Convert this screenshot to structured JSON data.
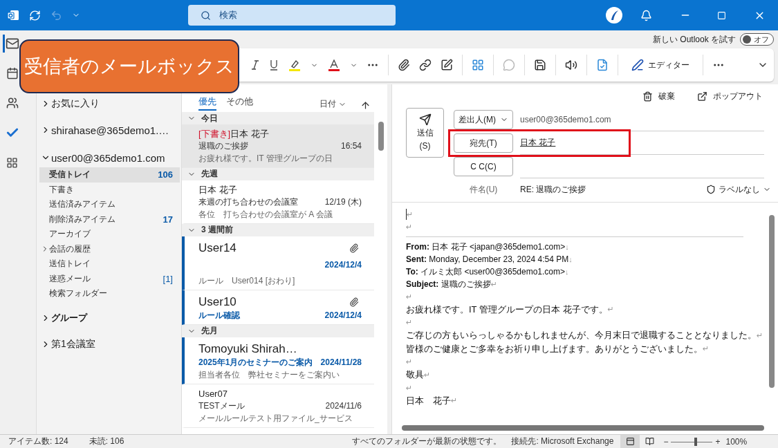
{
  "title_bar": {
    "search_placeholder": "検索"
  },
  "new_outlook": {
    "label": "新しい Outlook を試す",
    "toggle_label": "オフ",
    "on": false
  },
  "ribbon": {
    "editor_label": "エディター"
  },
  "callout": {
    "text": "受信者のメールボックス"
  },
  "nav_rail": [
    {
      "kind": "mail",
      "selected": true
    },
    {
      "kind": "calendar",
      "selected": false
    },
    {
      "kind": "people",
      "selected": false
    },
    {
      "kind": "todo",
      "selected": false
    },
    {
      "kind": "apps",
      "selected": false
    }
  ],
  "folder_tree": [
    {
      "kind": "favorites",
      "label": "お気に入り",
      "expanded": false
    },
    {
      "kind": "account",
      "label": "shirahase@365demo1.…",
      "expanded": false
    },
    {
      "kind": "account",
      "label": "user00@365demo1.com",
      "expanded": true,
      "children": [
        {
          "label": "受信トレイ",
          "count": "106",
          "selected": true
        },
        {
          "label": "下書き",
          "selected": false
        },
        {
          "label": "送信済みアイテム",
          "selected": false
        },
        {
          "label": "削除済みアイテム",
          "count": "17",
          "selected": false
        },
        {
          "label": "アーカイブ",
          "selected": false
        },
        {
          "label": "会話の履歴",
          "expanded": false,
          "selected": false
        },
        {
          "label": "送信トレイ",
          "selected": false
        },
        {
          "label": "迷惑メール",
          "count": "[1]",
          "selected": false
        },
        {
          "label": "検索フォルダー",
          "selected": false
        }
      ]
    },
    {
      "kind": "groups",
      "label": "グループ",
      "expanded": false
    },
    {
      "kind": "favorites",
      "label": "第1会議室",
      "expanded": false
    }
  ],
  "message_list": {
    "tabs": [
      {
        "label": "優先",
        "selected": true
      },
      {
        "label": "その他",
        "selected": false
      }
    ],
    "sort_label": "日付",
    "groups": [
      {
        "label": "今日",
        "expanded": true,
        "items": [
          {
            "draft_tag": "[下書き]",
            "sender": "日本 花子",
            "subject": "退職のご挨拶",
            "date": "16:54",
            "preview": "お疲れ様です。IT 管理グループの日",
            "unread": false,
            "attachment": false,
            "selected": true
          }
        ]
      },
      {
        "label": "先週",
        "expanded": true,
        "items": [
          {
            "sender": "日本 花子",
            "subject": "来週の打ち合わせの会議室",
            "date": "12/19 (木)",
            "preview": "各位　打ち合わせの会議室が A 会議",
            "unread": false,
            "attachment": false,
            "selected": false
          }
        ]
      },
      {
        "label": "3 週間前",
        "expanded": true,
        "items": [
          {
            "sender": "User14",
            "date": "2024/12/4",
            "preview": "ルール　User014 [おわり]",
            "unread": true,
            "attachment": true,
            "selected": false
          },
          {
            "sender": "User10",
            "subject": "ルール確認",
            "date": "2024/12/4",
            "unread": true,
            "attachment": true,
            "selected": false
          }
        ]
      },
      {
        "label": "先月",
        "expanded": true,
        "items": [
          {
            "sender": "Tomoyuki Shirah…",
            "subject": "2025年1月のセミナーのご案内",
            "date": "2024/11/28",
            "preview": "担当者各位　弊社セミナーをご案内い",
            "unread": true,
            "attachment": false,
            "selected": false
          },
          {
            "sender": "User07",
            "subject": "TESTメール",
            "date": "2024/11/6",
            "preview": "メールルールテスト用ファイル_サービス",
            "unread": false,
            "attachment": false,
            "selected": false
          }
        ]
      }
    ]
  },
  "compose": {
    "discard_label": "破棄",
    "popout_label": "ポップアウト",
    "send_label": "送信",
    "send_key": "(S)",
    "rows": [
      {
        "kind": "from",
        "button": "差出人(M)",
        "value": "user00@365demo1.com",
        "highlighted": false
      },
      {
        "kind": "to",
        "button": "宛先(T)",
        "value": "日本 花子",
        "highlighted": true
      },
      {
        "kind": "cc",
        "button": "C C(C)",
        "highlighted": false
      }
    ],
    "subject_label": "件名(U)",
    "subject_value": "RE: 退職のご挨拶",
    "sensitivity_label": "ラベルなし"
  },
  "body": [
    {
      "kind": "cursor",
      "mark": "↵"
    },
    {
      "kind": "blank",
      "mark": "↵"
    },
    {
      "kind": "rule"
    },
    {
      "kind": "header",
      "text": "**From:** 日本 花子 <japan@365demo1.com>",
      "mark": "↓"
    },
    {
      "kind": "header",
      "text": "**Sent:** Monday, December 23, 2024 4:54 PM",
      "mark": "↓"
    },
    {
      "kind": "header",
      "text": "**To:** イルミ太郎 <user00@365demo1.com>",
      "mark": "↓"
    },
    {
      "kind": "header",
      "text": "**Subject:** 退職のご挨拶",
      "mark": "↵"
    },
    {
      "kind": "blank",
      "mark": "↵"
    },
    {
      "kind": "text",
      "text": "お疲れ様です。IT 管理グループの日本 花子です。",
      "mark": "↵"
    },
    {
      "kind": "blank",
      "mark": "↵"
    },
    {
      "kind": "text",
      "text": "ご存じの方もいらっしゃるかもしれませんが、今月末日で退職することとなりました。",
      "mark": "↵"
    },
    {
      "kind": "text",
      "text": "皆様のご健康とご多幸をお祈り申し上げます。ありがとうございました。",
      "mark": "↵"
    },
    {
      "kind": "blank",
      "mark": "↵"
    },
    {
      "kind": "text",
      "text": "敬具",
      "mark": "↵"
    },
    {
      "kind": "blank",
      "mark": "↵"
    },
    {
      "kind": "text",
      "text": "日本　花子",
      "mark": "↵"
    }
  ],
  "status_bar": {
    "items": "アイテム数: 124",
    "unread": "未読: 106",
    "sync": "すべてのフォルダーが最新の状態です。",
    "connection": "接続先: Microsoft Exchange",
    "views": [
      {
        "kind": "normal",
        "selected": true
      },
      {
        "kind": "reading",
        "selected": false
      }
    ],
    "zoom_minus": "−",
    "zoom_plus": "+",
    "zoom": "100%",
    "level": 0.6
  }
}
